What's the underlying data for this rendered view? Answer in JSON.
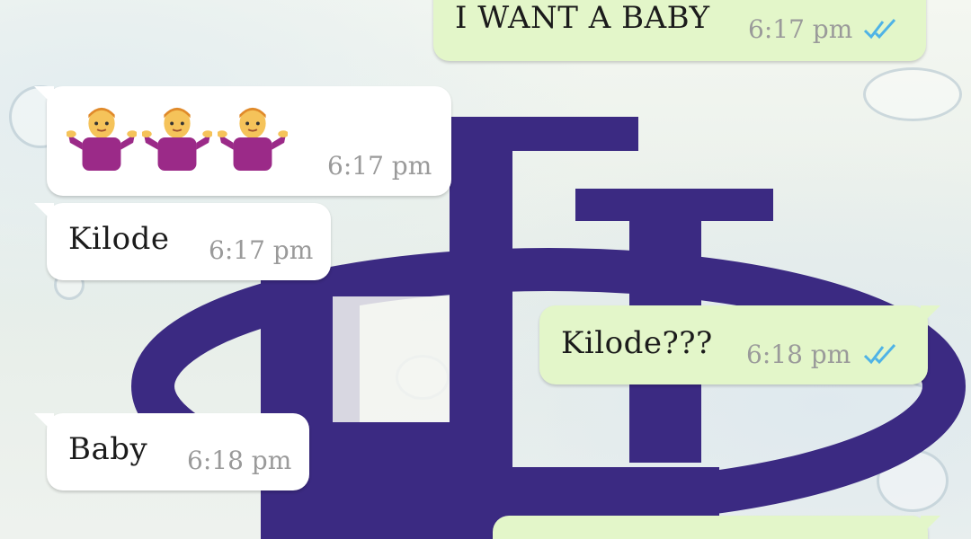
{
  "colors": {
    "incoming_bubble": "#ffffff",
    "outgoing_bubble": "#e3f6c9",
    "read_ticks": "#4fb3e6",
    "logo_purple": "#3b2a82"
  },
  "messages": [
    {
      "direction": "outgoing",
      "text": "I WANT A BABY",
      "time": "6:17 pm",
      "status_icon": "double-check-read-icon"
    },
    {
      "direction": "incoming",
      "emoji": [
        "person-shrugging-icon",
        "person-shrugging-icon",
        "person-shrugging-icon"
      ],
      "time": "6:17 pm"
    },
    {
      "direction": "incoming",
      "text": "Kilode",
      "time": "6:17 pm"
    },
    {
      "direction": "outgoing",
      "text": "Kilode???",
      "time": "6:18 pm",
      "status_icon": "double-check-read-icon"
    },
    {
      "direction": "incoming",
      "text": "Baby",
      "time": "6:18 pm"
    },
    {
      "direction": "outgoing",
      "text": "",
      "time": "",
      "partial": true
    }
  ]
}
